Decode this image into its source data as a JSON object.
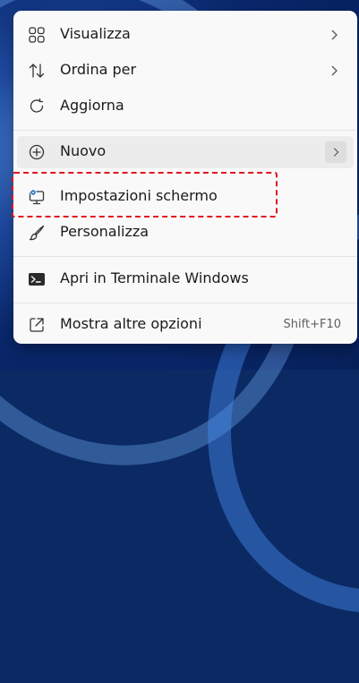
{
  "context_menu": {
    "items": [
      {
        "label": "Visualizza",
        "icon": "grid-icon",
        "submenu": true
      },
      {
        "label": "Ordina per",
        "icon": "sort-icon",
        "submenu": true
      },
      {
        "label": "Aggiorna",
        "icon": "refresh-icon",
        "submenu": false
      },
      {
        "label": "Nuovo",
        "icon": "plus-circle-icon",
        "submenu": true,
        "hovered": true
      },
      {
        "label": "Impostazioni schermo",
        "icon": "display-settings-icon",
        "submenu": false,
        "highlighted": true
      },
      {
        "label": "Personalizza",
        "icon": "brush-icon",
        "submenu": false
      },
      {
        "label": "Apri in Terminale Windows",
        "icon": "terminal-icon",
        "submenu": false
      },
      {
        "label": "Mostra altre opzioni",
        "icon": "open-external-icon",
        "submenu": false,
        "shortcut": "Shift+F10"
      }
    ]
  },
  "colors": {
    "menu_background": "#f9f9f9",
    "hover_background": "#ececec",
    "highlight_border": "#e0161e",
    "text": "#1b1b1b",
    "shortcut_text": "#5e5e5e"
  }
}
